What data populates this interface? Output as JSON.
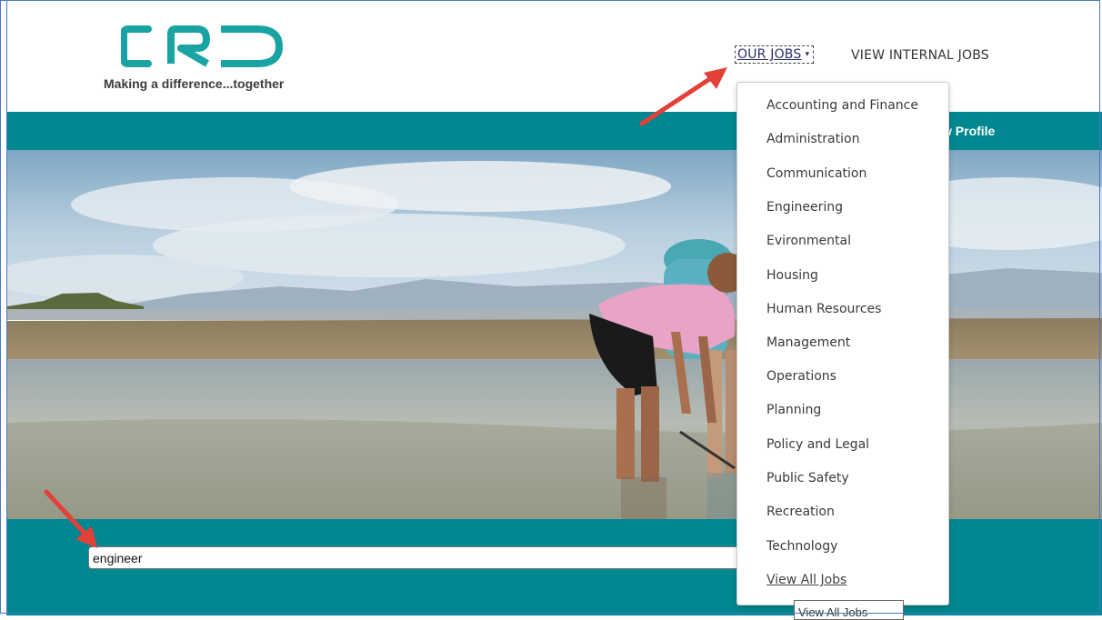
{
  "header": {
    "logo_text": "CRD",
    "tagline": "Making a difference...together",
    "nav": {
      "our_jobs": "OUR JOBS",
      "view_internal_jobs": "VIEW INTERNAL JOBS"
    }
  },
  "bar": {
    "view_profile": "w Profile"
  },
  "search": {
    "value": "engineer"
  },
  "dropdown": {
    "items": [
      "Accounting and Finance",
      "Administration",
      "Communication",
      "Engineering",
      "Evironmental",
      "Housing",
      "Human Resources",
      "Management",
      "Operations",
      "Planning",
      "Policy and Legal",
      "Public Safety",
      "Recreation",
      "Technology"
    ],
    "view_all": "View All Jobs"
  },
  "tooltip": {
    "text": "View All Jobs"
  },
  "colors": {
    "teal": "#00878f",
    "logo": "#1aa3a3",
    "arrow": "#e2413a"
  }
}
